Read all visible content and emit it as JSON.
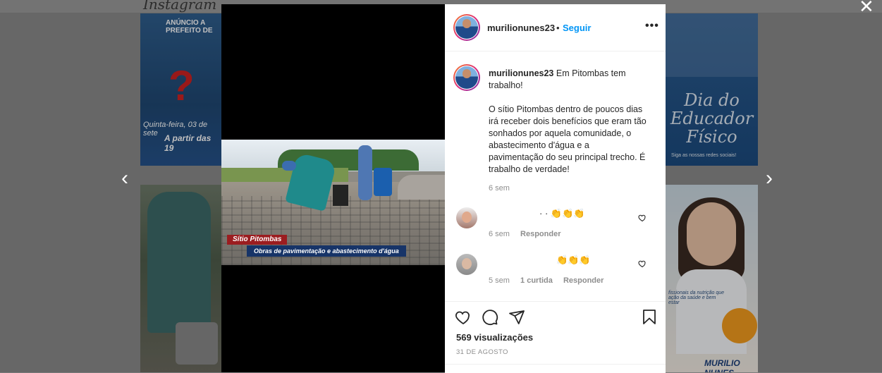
{
  "background": {
    "site_logo": "Instagram",
    "tile_a": {
      "line0": "ANÚNCIO A PREFEITO DE",
      "line1": "Quinta-feira, 03 de sete",
      "line2": "A partir das 19"
    },
    "tile_c": {
      "script": "Dia do Educador Físico",
      "foot": "Siga as nossas redes sociais!"
    },
    "tile_d": {
      "caption": "fissionais da nutrição que ação da saúde e bem estar",
      "brand": "MURILIO NUNES"
    }
  },
  "nav": {
    "prev": "‹",
    "next": "›",
    "close": "✕"
  },
  "media": {
    "tag_place": "Sítio Pitombas",
    "tag_title": "Obras de pavimentação e abastecimento d'água"
  },
  "post": {
    "username": "murilionunes23",
    "follow_dot": "•",
    "follow_label": "Seguir",
    "more_label": "•••",
    "caption_head": "Em Pitombas tem trabalho!",
    "caption_body": "O sítio Pitombas dentro de poucos dias irá receber dois benefícios que eram tão sonhados por aquela comunidade, o abastecimento d'água e a pavimentação do seu principal trecho. É trabalho de verdade!",
    "caption_time": "6 sem",
    "comments": [
      {
        "text": "· · 👏👏👏",
        "time": "6 sem",
        "likes": "",
        "reply": "Responder"
      },
      {
        "text": "👏👏👏",
        "time": "5 sem",
        "likes": "1 curtida",
        "reply": "Responder"
      }
    ],
    "views": "569 visualizações",
    "date": "31 DE AGOSTO"
  },
  "colors": {
    "follow_blue": "#0095f6",
    "text_dark": "#262626",
    "text_muted": "#8e8e8e"
  },
  "icons": [
    "heart-icon",
    "comment-icon",
    "share-icon",
    "bookmark-icon",
    "chevron-left-icon",
    "chevron-right-icon",
    "close-icon",
    "more-icon"
  ]
}
